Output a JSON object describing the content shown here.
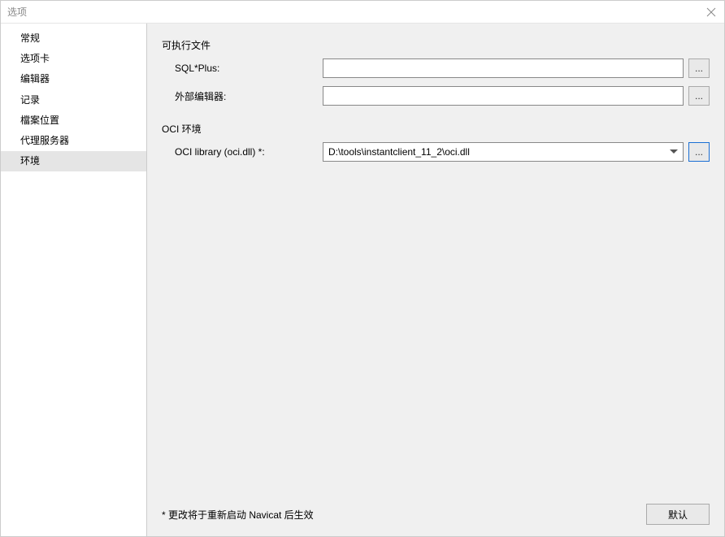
{
  "titlebar": {
    "title": "选项"
  },
  "sidebar": {
    "items": [
      {
        "label": "常规"
      },
      {
        "label": "选项卡"
      },
      {
        "label": "编辑器"
      },
      {
        "label": "记录"
      },
      {
        "label": "檔案位置"
      },
      {
        "label": "代理服务器"
      },
      {
        "label": "环境"
      }
    ],
    "selected_index": 6
  },
  "content": {
    "section_executable": "可执行文件",
    "sqlplus_label": "SQL*Plus:",
    "sqlplus_value": "",
    "external_editor_label": "外部编辑器:",
    "external_editor_value": "",
    "section_oci": "OCI 环境",
    "oci_library_label": "OCI library (oci.dll) *:",
    "oci_library_value": "D:\\tools\\instantclient_11_2\\oci.dll",
    "browse_label": "...",
    "footer_note": "* 更改将于重新启动 Navicat 后生效",
    "default_button": "默认"
  }
}
